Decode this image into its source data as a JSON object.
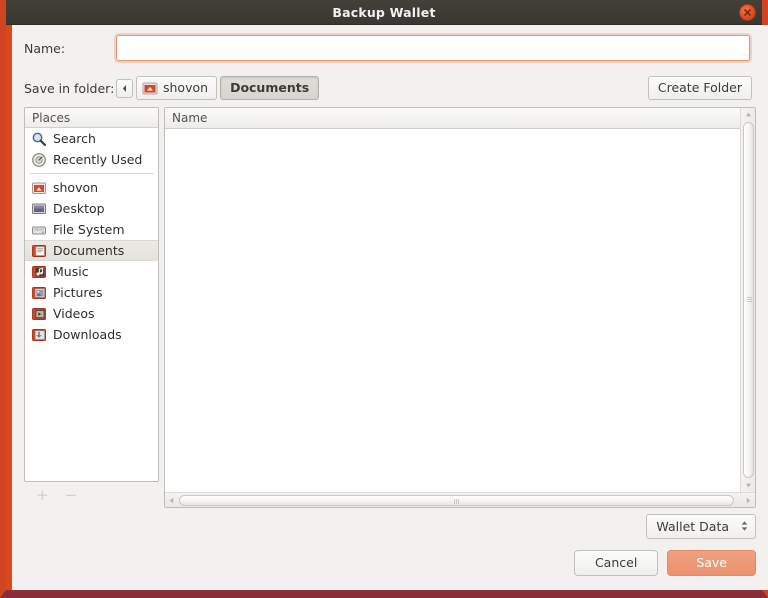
{
  "window": {
    "title": "Backup Wallet",
    "close_icon": "close-icon",
    "accent_orange": "#d84a1b",
    "titlebar_bg": "#3a3733"
  },
  "form": {
    "name_label": "Name:",
    "name_value": "",
    "name_placeholder": "",
    "folder_label": "Save in folder:",
    "create_folder_label": "Create Folder"
  },
  "pathbar": {
    "prev_icon": "chevron-left-icon",
    "buttons": [
      {
        "label": "shovon",
        "icon": "home-folder-icon",
        "active": false
      },
      {
        "label": "Documents",
        "icon": "",
        "active": true
      }
    ]
  },
  "places": {
    "header": "Places",
    "items": [
      {
        "label": "Search",
        "icon": "search-icon",
        "selected": false
      },
      {
        "label": "Recently Used",
        "icon": "recent-icon",
        "selected": false
      },
      {
        "label": "shovon",
        "icon": "home-folder-icon",
        "selected": false
      },
      {
        "label": "Desktop",
        "icon": "desktop-icon",
        "selected": false
      },
      {
        "label": "File System",
        "icon": "drive-icon",
        "selected": false
      },
      {
        "label": "Documents",
        "icon": "documents-icon",
        "selected": true
      },
      {
        "label": "Music",
        "icon": "music-icon",
        "selected": false
      },
      {
        "label": "Pictures",
        "icon": "pictures-icon",
        "selected": false
      },
      {
        "label": "Videos",
        "icon": "videos-icon",
        "selected": false
      },
      {
        "label": "Downloads",
        "icon": "downloads-icon",
        "selected": false
      }
    ],
    "add_label": "+",
    "remove_label": "−"
  },
  "filelist": {
    "column_header": "Name",
    "rows": []
  },
  "filter": {
    "selected": "Wallet Data"
  },
  "actions": {
    "cancel_label": "Cancel",
    "save_label": "Save"
  }
}
